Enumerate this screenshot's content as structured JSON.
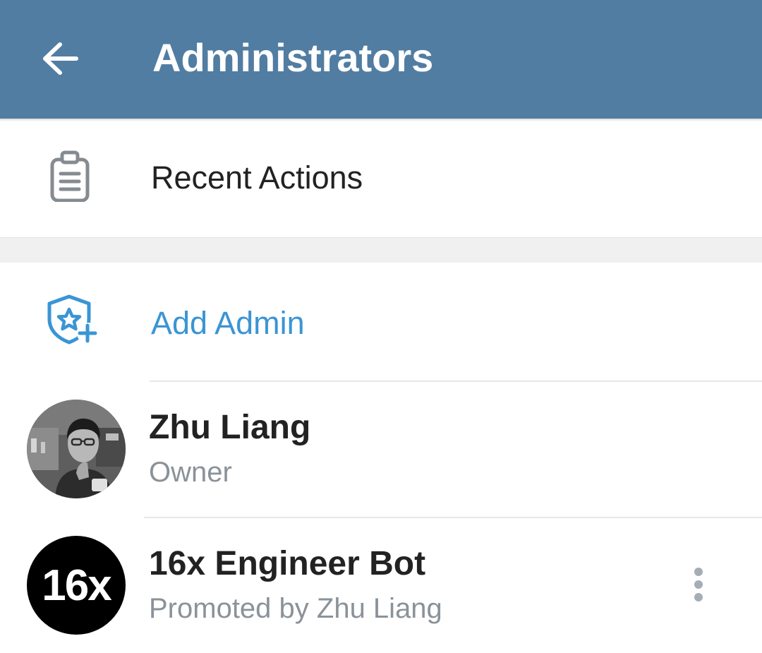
{
  "header": {
    "title": "Administrators",
    "back_icon": "arrow-left-icon"
  },
  "menu": {
    "recent_actions": {
      "label": "Recent Actions",
      "icon": "clipboard-icon"
    },
    "add_admin": {
      "label": "Add Admin",
      "icon": "shield-star-plus-icon"
    }
  },
  "admins": [
    {
      "name": "Zhu Liang",
      "role": "Owner",
      "avatar": "user-photo"
    },
    {
      "name": "16x Engineer Bot",
      "role": "Promoted by Zhu Liang",
      "avatar_text": "16x",
      "more_icon": "more-vertical-icon"
    }
  ],
  "colors": {
    "header_bg": "#517da2",
    "accent": "#3a95d5",
    "secondary_text": "#8a9299",
    "primary_text": "#222222"
  }
}
